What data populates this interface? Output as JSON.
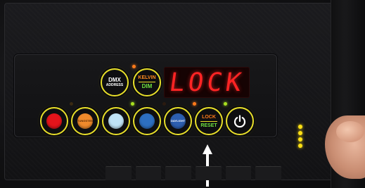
{
  "display": {
    "text": "LOCK"
  },
  "buttons": {
    "dmx": {
      "line1": "DMX",
      "line2": "ADDRESS"
    },
    "kelvin_dim": {
      "line1": "KELVIN",
      "line2": "DIM"
    },
    "tungsten": {
      "label": "TUNGSTEN"
    },
    "daylight": {
      "label": "DAYLIGHT"
    },
    "lock_reset": {
      "line1": "LOCK",
      "line2": "RESET"
    },
    "power": {
      "icon": "power-icon"
    }
  },
  "colors": {
    "ring": "#e8df2a",
    "display_text": "#ff2424",
    "indicator_orange": "#ff7a1a",
    "indicator_green": "#a8e020",
    "kelvin_label": "#ff8a1e",
    "dim_label": "#6ee040",
    "lock_label": "#ff7a1a",
    "reset_label": "#6ee040",
    "red_swatch": "#e3141b",
    "orange_swatch": "#f08a2c",
    "light_blue_swatch": "#bfe3f6",
    "blue_swatch": "#2d6fc0",
    "battery_indicator": "#ffe014"
  }
}
